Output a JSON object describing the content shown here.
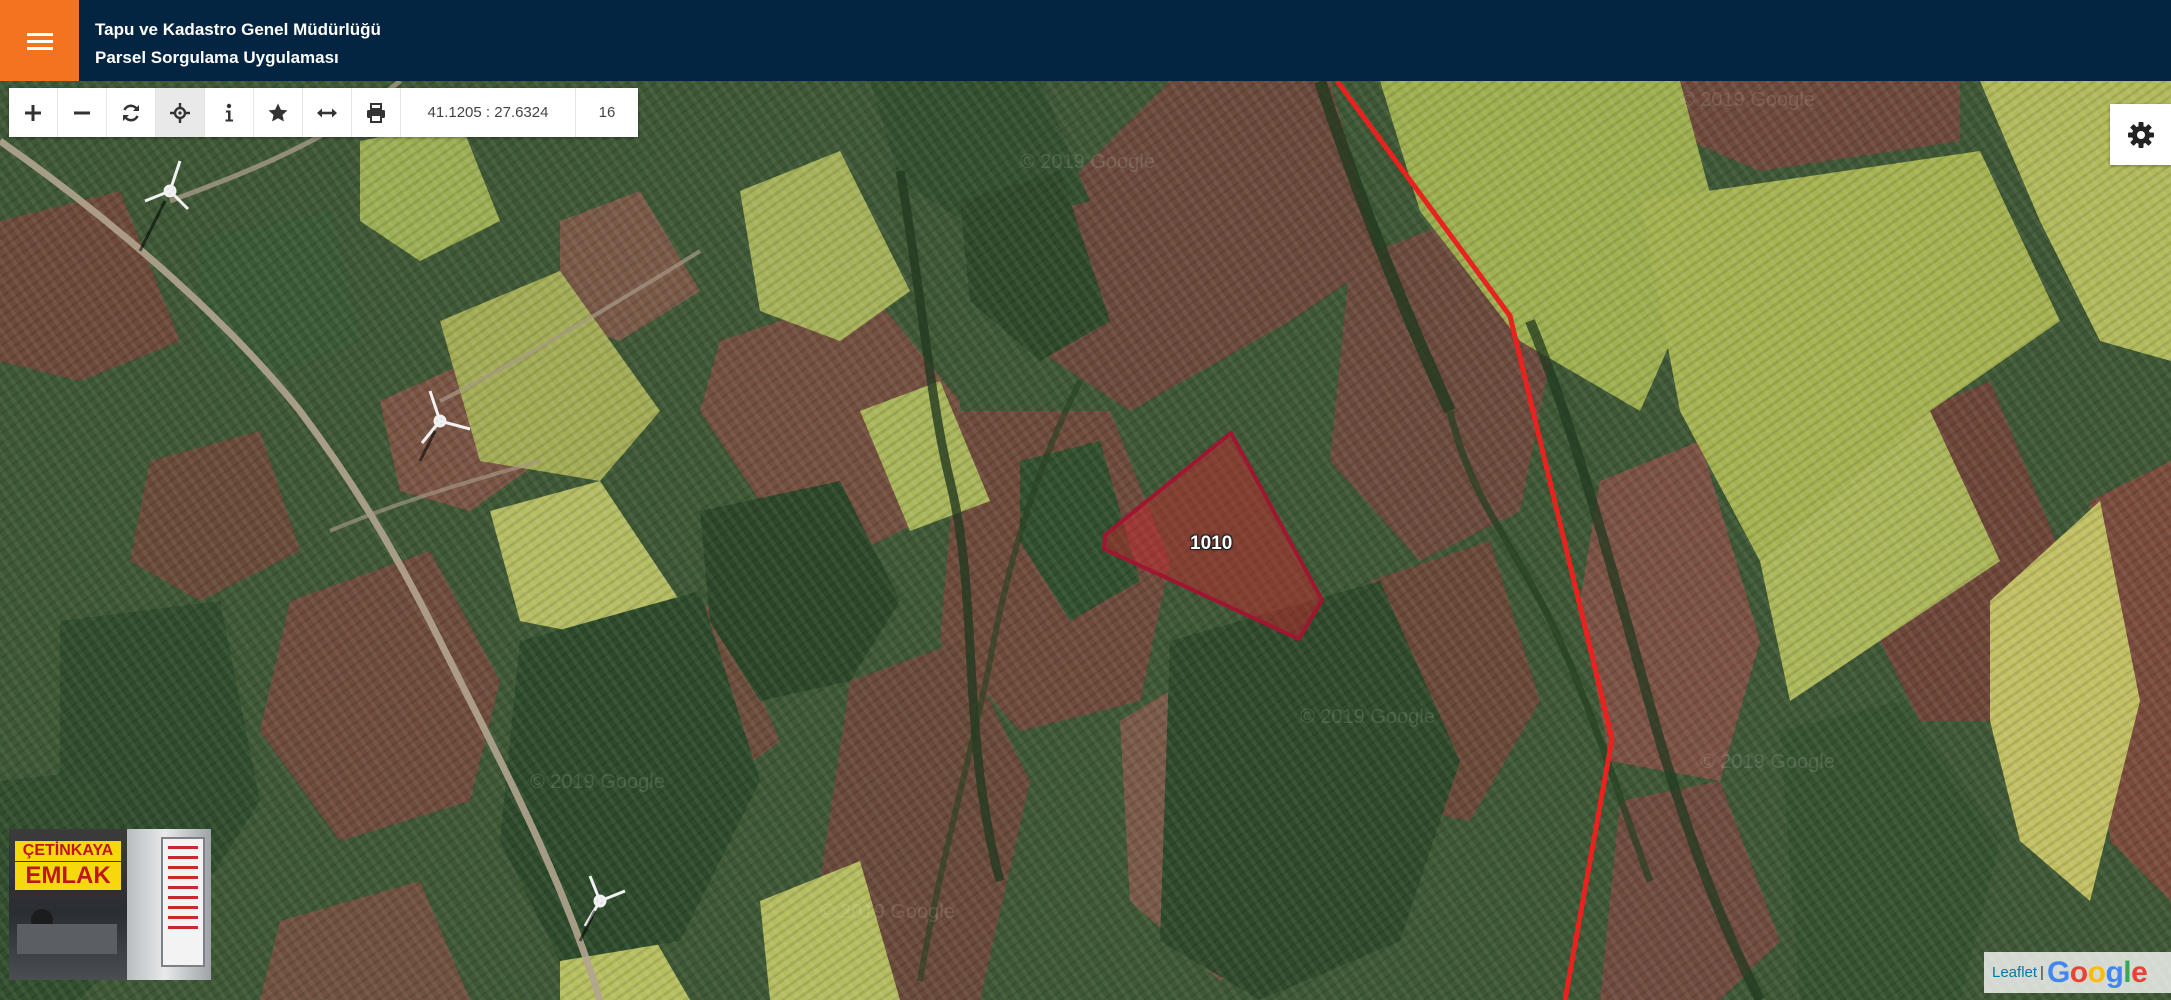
{
  "header": {
    "title_line1": "Tapu ve Kadastro Genel Müdürlüğü",
    "title_line2": "Parsel Sorgulama Uygulaması",
    "background_color": "#042541",
    "menu_button_color": "#f47321",
    "menu_icon": "hamburger-icon"
  },
  "toolbar": {
    "tools": [
      {
        "name": "zoom-in",
        "icon": "plus-icon"
      },
      {
        "name": "zoom-out",
        "icon": "minus-icon"
      },
      {
        "name": "refresh",
        "icon": "refresh-icon"
      },
      {
        "name": "pan",
        "icon": "crosshair-move-icon",
        "active": true
      },
      {
        "name": "info",
        "icon": "info-icon"
      },
      {
        "name": "favorite",
        "icon": "star-icon"
      },
      {
        "name": "measure",
        "icon": "horizontal-arrows-icon"
      },
      {
        "name": "print",
        "icon": "print-icon"
      }
    ],
    "coordinates": "41.1205 : 27.6324",
    "zoom_level": "16"
  },
  "map": {
    "parcel_label": "1010",
    "parcel_color": "#b0203a",
    "boundary_line_color": "#e8221f",
    "watermark_text": "© 2019 Google"
  },
  "settings": {
    "icon": "gear-icon"
  },
  "ad": {
    "business_name": "ÇETİNKAYA",
    "business_type": "EMLAK"
  },
  "attribution": {
    "leaflet_text": "Leaflet",
    "separator": "|",
    "google_text": "Google"
  }
}
